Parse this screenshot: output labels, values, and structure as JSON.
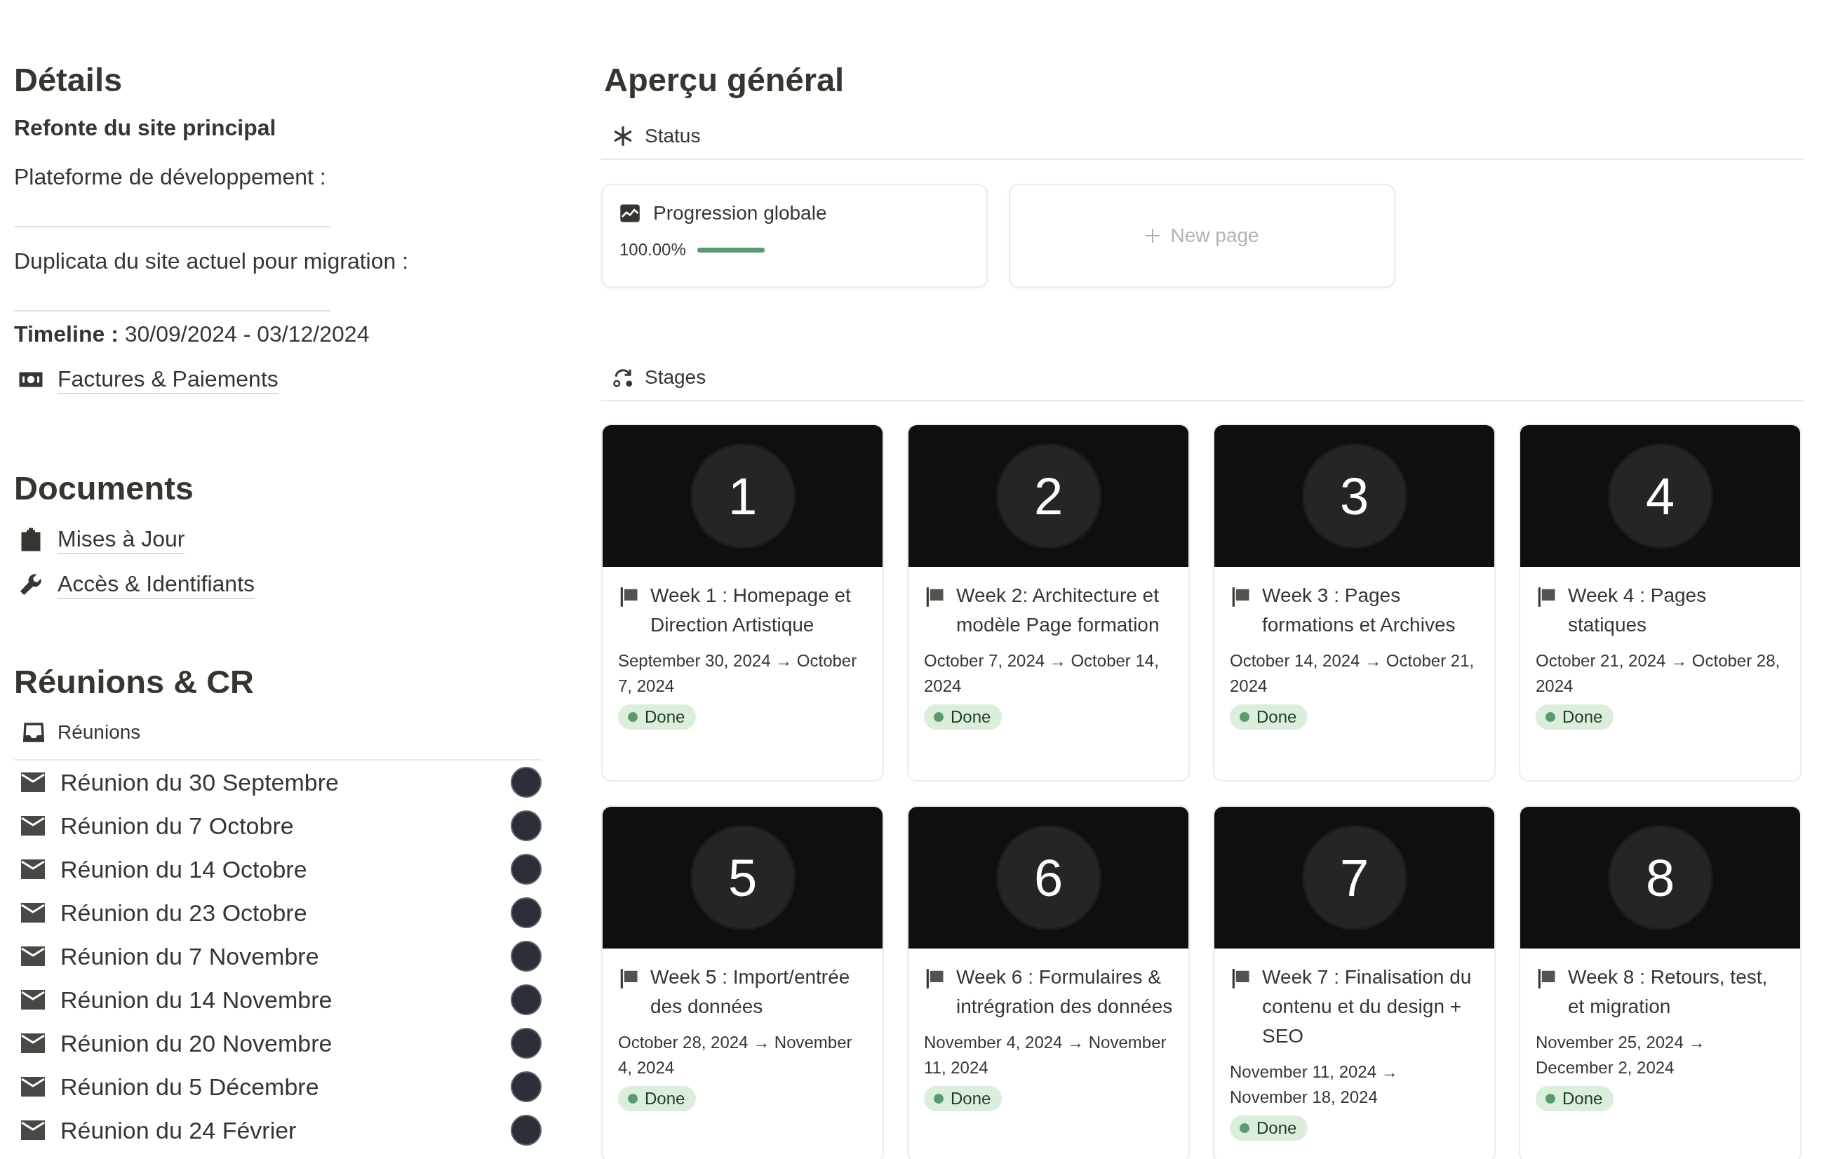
{
  "details": {
    "title": "Détails",
    "subtitle": "Refonte du site principal",
    "fields": [
      {
        "label": "Plateforme de développement :"
      },
      {
        "label": "Duplicata du site actuel pour migration :"
      }
    ],
    "timeline": {
      "label": "Timeline :",
      "value": "30/09/2024 - 03/12/2024"
    },
    "links": [
      {
        "label": "Factures & Paiements",
        "kind": "money"
      }
    ]
  },
  "documents": {
    "title": "Documents",
    "links": [
      {
        "label": "Mises à Jour",
        "kind": "clipboard"
      },
      {
        "label": "Accès & Identifiants",
        "kind": "wrench"
      }
    ]
  },
  "meetings": {
    "title": "Réunions & CR",
    "database": "Réunions",
    "rows": [
      {
        "title": "Réunion du 30 Septembre"
      },
      {
        "title": "Réunion du 7 Octobre"
      },
      {
        "title": "Réunion du 14 Octobre"
      },
      {
        "title": "Réunion du 23 Octobre"
      },
      {
        "title": "Réunion du 7 Novembre"
      },
      {
        "title": "Réunion du 14 Novembre"
      },
      {
        "title": "Réunion du 20 Novembre"
      },
      {
        "title": "Réunion du 5 Décembre"
      },
      {
        "title": "Réunion du 24 Février"
      }
    ]
  },
  "overview": {
    "title": "Aperçu général",
    "status": {
      "label": "Status",
      "cards": [
        {
          "kind": "progress",
          "title": "Progression globale",
          "reading": "100.00%",
          "level": 1
        },
        {
          "kind": "new",
          "label": "New page"
        }
      ]
    },
    "stages": {
      "label": "Stages",
      "cards": [
        {
          "number": "1",
          "title": "Week 1 : Homepage et Direction Artistique",
          "dates": "September 30, 2024 → October 7, 2024",
          "status": "Done"
        },
        {
          "number": "2",
          "title": "Week 2: Architecture et modèle Page formation",
          "dates": "October 7, 2024 → October 14, 2024",
          "status": "Done"
        },
        {
          "number": "3",
          "title": "Week 3 : Pages formations et Archives",
          "dates": "October 14, 2024 → October 21, 2024",
          "status": "Done"
        },
        {
          "number": "4",
          "title": "Week 4 : Pages statiques",
          "dates": "October 21, 2024 → October 28, 2024",
          "status": "Done"
        },
        {
          "number": "5",
          "title": "Week 5 : Import/entrée des données",
          "dates": "October 28, 2024 → November 4, 2024",
          "status": "Done"
        },
        {
          "number": "6",
          "title": "Week 6 : Formulaires & intrégration des données",
          "dates": "November 4, 2024 → November 11, 2024",
          "status": "Done"
        },
        {
          "number": "7",
          "title": "Week 7 : Finalisation du contenu et du design + SEO",
          "dates": "November 11, 2024 → November 18, 2024",
          "status": "Done"
        },
        {
          "number": "8",
          "title": "Week 8 : Retours, test, et migration",
          "dates": "November 25, 2024 → December 2, 2024",
          "status": "Done"
        }
      ]
    }
  }
}
